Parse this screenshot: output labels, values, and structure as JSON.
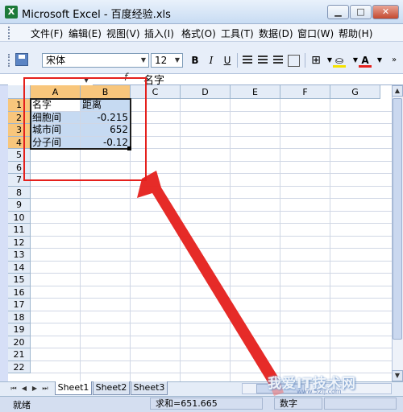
{
  "window": {
    "title": "Microsoft Excel - 百度经验.xls",
    "app_icon": "X",
    "minimize_label": "▁",
    "maximize_label": "□",
    "close_label": "✕"
  },
  "menu": {
    "items": [
      "文件(F)",
      "编辑(E)",
      "视图(V)",
      "插入(I)",
      "格式(O)",
      "工具(T)",
      "数据(D)",
      "窗口(W)",
      "帮助(H)"
    ],
    "mdi_minimize": "‒",
    "mdi_restore": "⧉",
    "mdi_close": "✕"
  },
  "toolbar": {
    "font_name": "宋体",
    "font_size": "12",
    "bold": "B",
    "italic": "I",
    "underline": "U",
    "font_color_label": "A",
    "fill_color": "#f5e200",
    "font_color": "#e5201c"
  },
  "formula_bar": {
    "name_box": "",
    "fx": "f",
    "content": "名字"
  },
  "grid": {
    "columns": [
      "A",
      "B",
      "C",
      "D",
      "E",
      "F",
      "G"
    ],
    "rows": [
      "1",
      "2",
      "3",
      "4",
      "5",
      "6",
      "7",
      "8",
      "9",
      "10",
      "11",
      "12",
      "13",
      "14",
      "15",
      "16",
      "17",
      "18",
      "19",
      "20",
      "21",
      "22"
    ],
    "selected_columns": [
      "A",
      "B"
    ],
    "selected_rows": [
      "1",
      "2",
      "3",
      "4"
    ],
    "cells": [
      [
        "名字",
        "距离"
      ],
      [
        "细胞间",
        "-0.215"
      ],
      [
        "城市间",
        "652"
      ],
      [
        "分子间",
        "-0.12"
      ]
    ]
  },
  "sheets": {
    "tabs": [
      "Sheet1",
      "Sheet2",
      "Sheet3"
    ],
    "active": "Sheet1",
    "nav": [
      "⏮",
      "◀",
      "▶",
      "⏭"
    ]
  },
  "status": {
    "ready": "就绪",
    "sum": "求和=651.665",
    "mode": "数字"
  },
  "watermark": {
    "text": "我爱IT技术网",
    "sub": "www.52ij.com"
  },
  "colors": {
    "annotation_red": "#e5201c",
    "selection_fill": "#c6daf2",
    "header_highlight": "#f8c67c"
  }
}
